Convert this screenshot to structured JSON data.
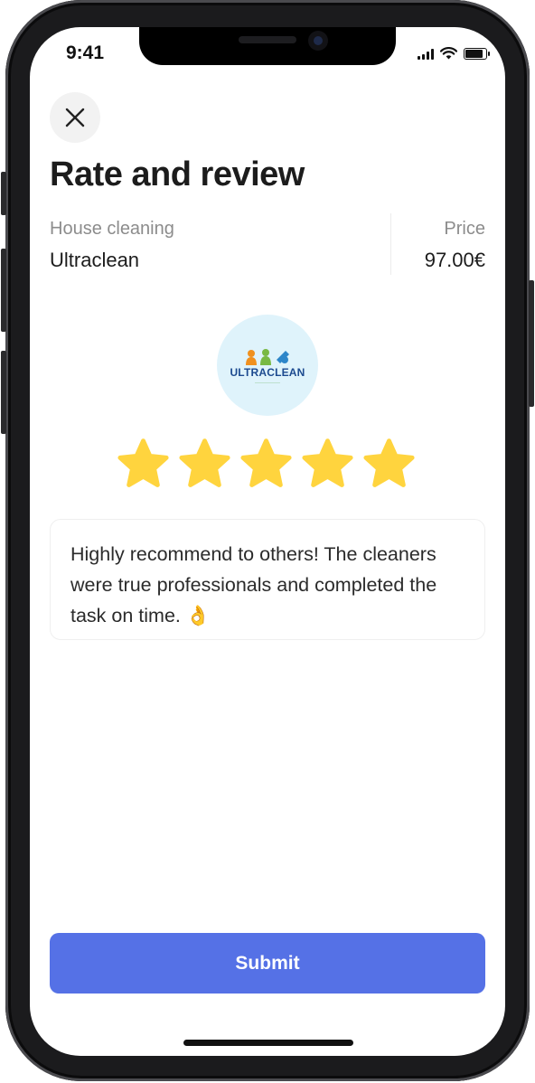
{
  "status_bar": {
    "time": "9:41"
  },
  "header": {
    "title": "Rate and review"
  },
  "service": {
    "category_label": "House cleaning",
    "provider_name": "Ultraclean",
    "price_label": "Price",
    "price_value": "97.00€"
  },
  "logo": {
    "word": "ULTRACLEAN"
  },
  "rating": {
    "value": 5,
    "max": 5,
    "color": "#ffd43e"
  },
  "review": {
    "text": "Highly recommend to others! The cleaners were true professionals and completed the task on time. 👌"
  },
  "actions": {
    "submit_label": "Submit",
    "submit_color": "#5571e6"
  }
}
